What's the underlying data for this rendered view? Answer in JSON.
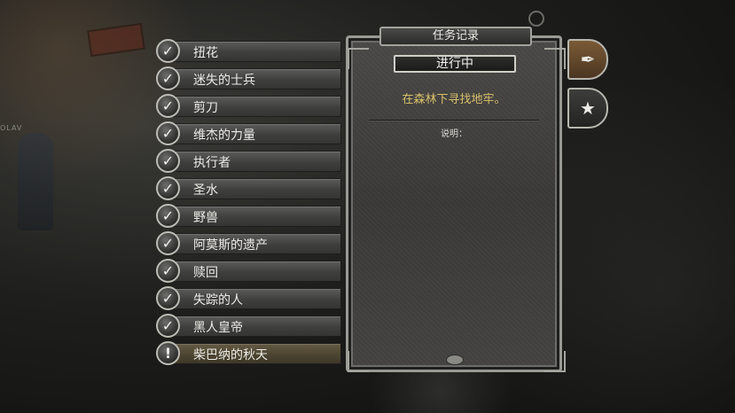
{
  "scene": {
    "banner_text": "OLAV"
  },
  "quest_log": {
    "title": "任务记录",
    "status_tag": "进行中",
    "objective": "在森林下寻找地牢。",
    "description_label": "说明："
  },
  "quests": [
    {
      "title": "扭花",
      "state": "completed",
      "icon": "check-icon",
      "mark": "✓"
    },
    {
      "title": "迷失的士兵",
      "state": "completed",
      "icon": "check-icon",
      "mark": "✓"
    },
    {
      "title": "剪刀",
      "state": "completed",
      "icon": "check-icon",
      "mark": "✓"
    },
    {
      "title": "维杰的力量",
      "state": "completed",
      "icon": "check-icon",
      "mark": "✓"
    },
    {
      "title": "执行者",
      "state": "completed",
      "icon": "check-icon",
      "mark": "✓"
    },
    {
      "title": "圣水",
      "state": "completed",
      "icon": "check-icon",
      "mark": "✓"
    },
    {
      "title": "野兽",
      "state": "completed",
      "icon": "check-icon",
      "mark": "✓"
    },
    {
      "title": "阿莫斯的遗产",
      "state": "completed",
      "icon": "check-icon",
      "mark": "✓"
    },
    {
      "title": "赎回",
      "state": "completed",
      "icon": "check-icon",
      "mark": "✓"
    },
    {
      "title": "失踪的人",
      "state": "completed",
      "icon": "check-icon",
      "mark": "✓"
    },
    {
      "title": "黑人皇帝",
      "state": "completed",
      "icon": "check-icon",
      "mark": "✓"
    },
    {
      "title": "柴巴纳的秋天",
      "state": "active",
      "icon": "exclamation-icon",
      "mark": "!"
    }
  ],
  "side_tabs": [
    {
      "id": "quests",
      "icon": "quill-icon",
      "glyph": "✒",
      "selected": true
    },
    {
      "id": "achievements",
      "icon": "star-laurel-icon",
      "glyph": "★",
      "selected": false
    }
  ],
  "colors": {
    "objective_text": "#d9c06a",
    "active_quest_bar": "#4d4532"
  }
}
